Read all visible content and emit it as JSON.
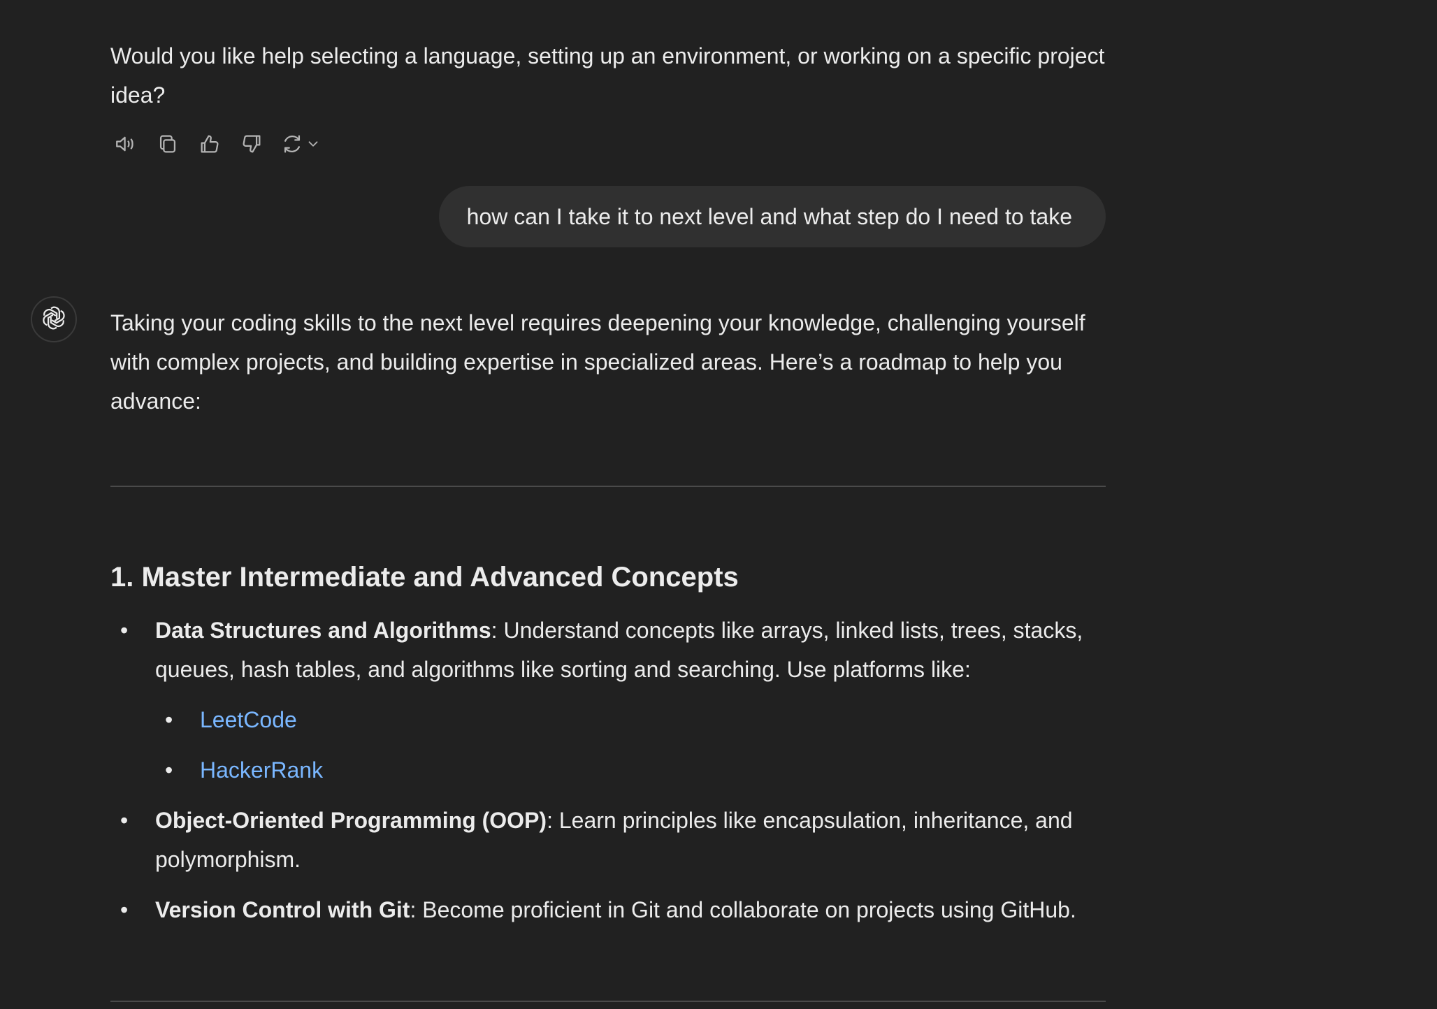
{
  "previous_message": {
    "text": "Would you like help selecting a language, setting up an environment, or working on a specific project idea?"
  },
  "message_actions": {
    "icons": [
      "speaker-icon",
      "copy-icon",
      "thumbs-up-icon",
      "thumbs-down-icon",
      "regenerate-icon",
      "chevron-down-icon"
    ]
  },
  "user_message": {
    "text": "how can I take it to next level and what step do I need to take"
  },
  "assistant": {
    "avatar_icon": "openai-logo-icon",
    "intro": "Taking your coding skills to the next level requires deepening your knowledge, challenging yourself with complex projects, and building expertise in specialized areas. Here’s a roadmap to help you advance:",
    "section1": {
      "heading": "1. Master Intermediate and Advanced Concepts",
      "items": [
        {
          "title": "Data Structures and Algorithms",
          "text": ": Understand concepts like arrays, linked lists, trees, stacks, queues, hash tables, and algorithms like sorting and searching. Use platforms like:",
          "links": [
            "LeetCode",
            "HackerRank"
          ]
        },
        {
          "title": "Object-Oriented Programming (OOP)",
          "text": ": Learn principles like encapsulation, inheritance, and polymorphism."
        },
        {
          "title": "Version Control with Git",
          "text": ": Become proficient in Git and collaborate on projects using GitHub."
        }
      ]
    }
  },
  "colors": {
    "background": "#212121",
    "bubble": "#303030",
    "text": "#ececec",
    "link": "#7ab7ff",
    "divider": "#4a4a4a"
  }
}
